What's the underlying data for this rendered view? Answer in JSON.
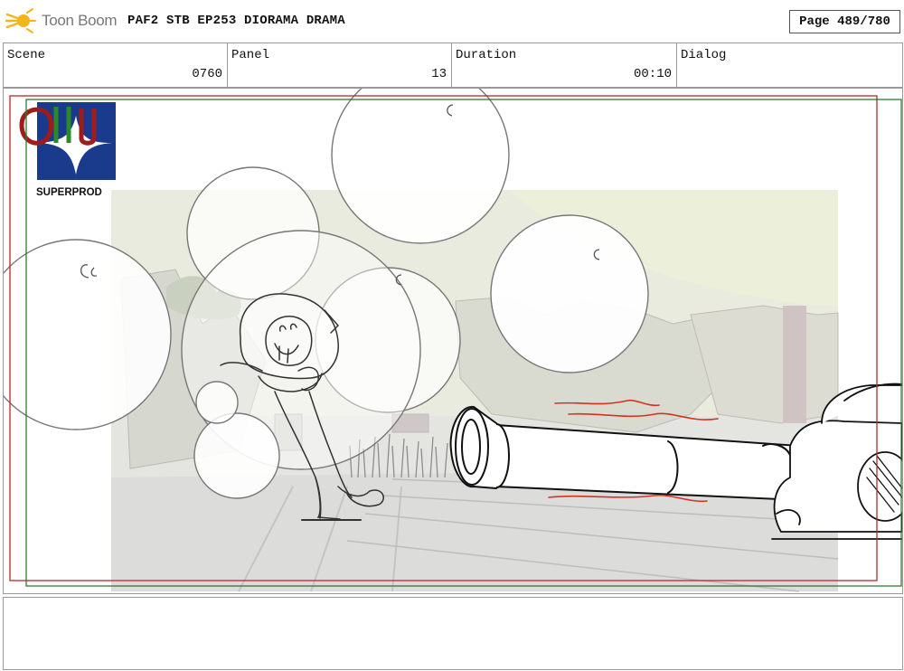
{
  "app": {
    "brand": "Toon Boom",
    "doc_title": "PAF2  STB  EP253  DIORAMA  DRAMA",
    "page_label": "Page 489/780"
  },
  "meta": {
    "scene_label": "Scene",
    "scene_value": "0760",
    "panel_label": "Panel",
    "panel_value": "13",
    "duration_label": "Duration",
    "duration_value": "00:10",
    "dialog_label": "Dialog",
    "dialog_value": ""
  },
  "watermark": {
    "logo_text": "SUPERPROD"
  },
  "colors": {
    "safe_frame_red": "#b8262e",
    "action_frame_green": "#2f7a2f",
    "sketch_red": "#d8321e",
    "logo_blue": "#1a3a8c",
    "brand_yellow": "#f2b61b"
  },
  "icons": {
    "brand": "toon-boom-logo-icon"
  },
  "notes": ""
}
